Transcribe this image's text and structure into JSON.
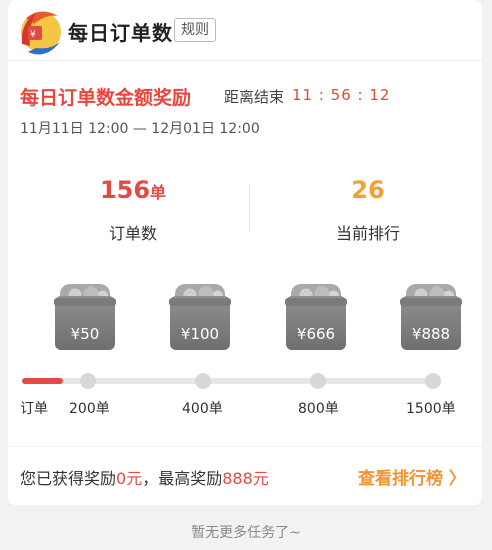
{
  "header": {
    "title": "每日订单数",
    "rules_label": "规则",
    "logo": "orbit-logo-icon"
  },
  "reward": {
    "title": "每日订单数金额奖励",
    "countdown_label": "距离结束",
    "countdown_value": "11 : 56 : 12",
    "date_range": "11月11日 12:00 — 12月01日 12:00"
  },
  "stats": {
    "orders_value": "156",
    "orders_unit": "单",
    "orders_label": "订单数",
    "rank_value": "26",
    "rank_label": "当前排行"
  },
  "gifts": [
    {
      "amount": "¥50",
      "icon": "red-envelope-icon"
    },
    {
      "amount": "¥100",
      "icon": "red-envelope-icon"
    },
    {
      "amount": "¥666",
      "icon": "red-envelope-icon"
    },
    {
      "amount": "¥888",
      "icon": "red-envelope-icon"
    }
  ],
  "progress": {
    "ticks": [
      "订单",
      "200单",
      "400单",
      "800单",
      "1500单"
    ],
    "fill_fraction": 0.1
  },
  "summary": {
    "prefix": "您已获得奖励",
    "earned": "0元",
    "mid": "，最高奖励",
    "max": "888元"
  },
  "leaderboard_label": "查看排行榜 〉",
  "footer_note": "暂无更多任务了~",
  "colors": {
    "accent_red": "#e14b43",
    "accent_orange": "#f0a332"
  }
}
